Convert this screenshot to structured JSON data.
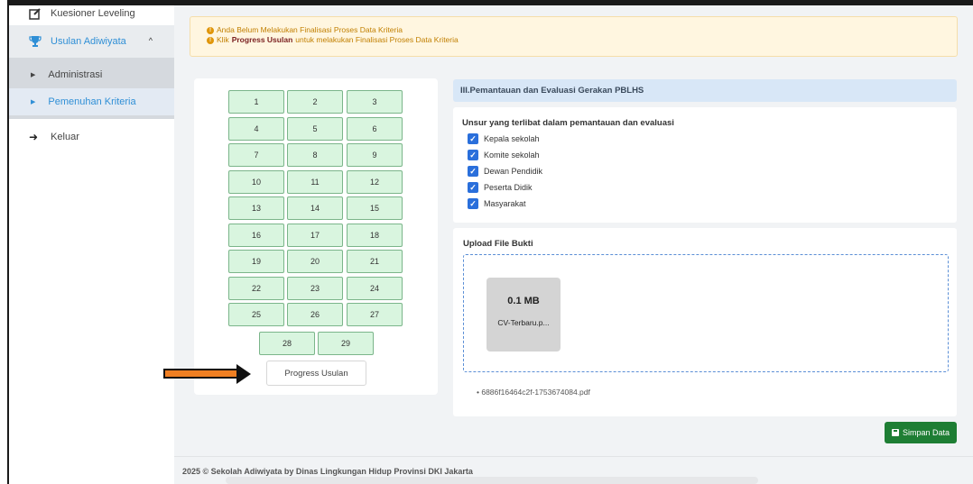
{
  "sidebar": {
    "kuesioner_label": "Kuesioner Leveling",
    "usulan_label": "Usulan Adiwiyata",
    "usulan_caret": "^",
    "administrasi_label": "Administrasi",
    "pemenuhan_label": "Pemenuhan Kriteria",
    "keluar_label": "Keluar",
    "accent_color": "#2f8fd6"
  },
  "alert": {
    "line1": "Anda Belum Melakukan Finalisasi Proses Data Kriteria",
    "line2_prefix": "Klik",
    "line2_bold": "Progress Usulan",
    "line2_suffix": "untuk melakukan Finalisasi Proses Data Kriteria",
    "icon": "exclamation-circle-icon"
  },
  "criteria_numbers": [
    "1",
    "2",
    "3",
    "4",
    "5",
    "6",
    "7",
    "8",
    "9",
    "10",
    "11",
    "12",
    "13",
    "14",
    "15",
    "16",
    "17",
    "18",
    "19",
    "20",
    "21",
    "22",
    "23",
    "24",
    "25",
    "26",
    "27",
    "28",
    "29"
  ],
  "progress_button_label": "Progress Usulan",
  "section": {
    "title": "III.Pemantauan dan Evaluasi Gerakan PBLHS",
    "question": "Unsur yang terlibat dalam pemantauan dan evaluasi",
    "options": [
      {
        "label": "Kepala sekolah",
        "checked": true
      },
      {
        "label": "Komite sekolah",
        "checked": true
      },
      {
        "label": "Dewan Pendidik",
        "checked": true
      },
      {
        "label": "Peserta Didik",
        "checked": true
      },
      {
        "label": "Masyarakat",
        "checked": true
      }
    ]
  },
  "upload": {
    "title": "Upload File Bukti",
    "file_size": "0.1 MB",
    "file_name": "CV-Terbaru.p...",
    "uploaded_file": "6886f16464c2f-1753674084.pdf"
  },
  "save_button_label": "Simpan Data",
  "footer_text": "2025 © Sekolah Adiwiyata by Dinas Lingkungan Hidup Provinsi DKI Jakarta",
  "colors": {
    "number_button_bg": "#d9f5df",
    "save_button_bg": "#1e7e34",
    "arrow": "#f07f22"
  }
}
